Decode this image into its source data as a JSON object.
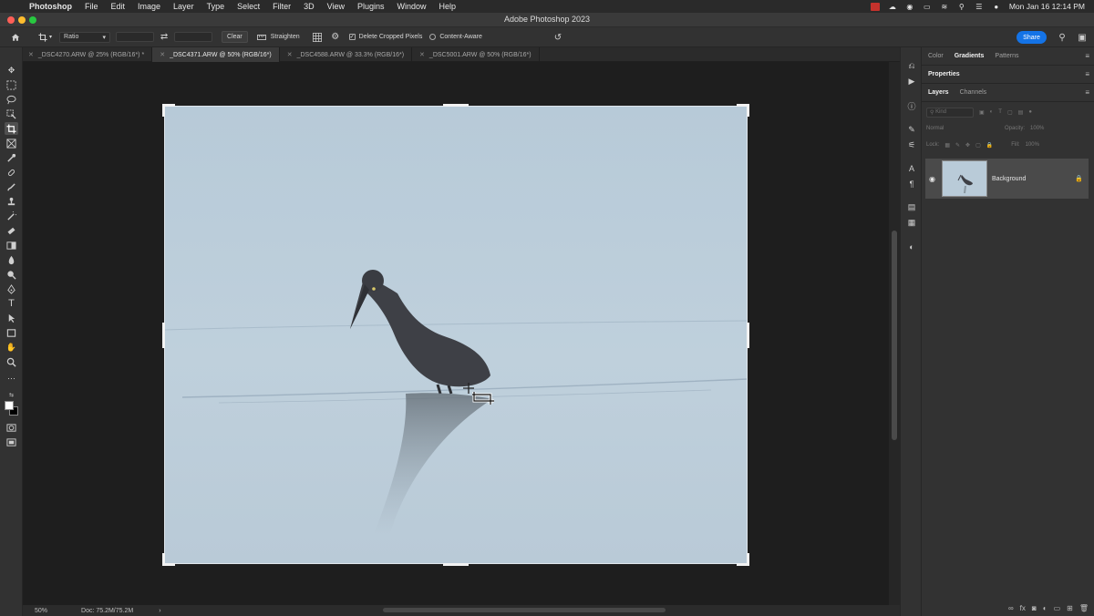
{
  "menubar": {
    "app_name": "Photoshop",
    "items": [
      "File",
      "Edit",
      "Image",
      "Layer",
      "Type",
      "Select",
      "Filter",
      "3D",
      "View",
      "Plugins",
      "Window",
      "Help"
    ],
    "clock": "Mon Jan 16  12:14 PM"
  },
  "window": {
    "title": "Adobe Photoshop 2023"
  },
  "options": {
    "ratio_label": "Ratio",
    "clear_label": "Clear",
    "straighten_label": "Straighten",
    "delete_cropped_label": "Delete Cropped Pixels",
    "content_aware_label": "Content-Aware",
    "share_label": "Share"
  },
  "tabs": [
    {
      "label": "_DSC4270.ARW @ 25% (RGB/16*) *"
    },
    {
      "label": "_DSC4371.ARW @ 50% (RGB/16*)"
    },
    {
      "label": "_DSC4588.ARW @ 33.3% (RGB/16*)"
    },
    {
      "label": "_DSC5001.ARW @ 50% (RGB/16*)"
    }
  ],
  "status": {
    "zoom": "50%",
    "doc": "Doc: 75.2M/75.2M",
    "arrow": "›"
  },
  "panels": {
    "top_tabs": [
      "Color",
      "Gradients",
      "Patterns"
    ],
    "properties_label": "Properties",
    "layers_tabs": [
      "Layers",
      "Channels"
    ],
    "kind_placeholder": "Kind",
    "blend_mode": "Normal",
    "opacity_label": "Opacity:",
    "opacity_value": "100%",
    "lock_label": "Lock:",
    "fill_label": "Fill:",
    "fill_value": "100%",
    "layer_name": "Background"
  },
  "colors": {
    "accent": "#1473e6",
    "photo_sky": "#b9cbd8",
    "heron": "#3e4045"
  }
}
